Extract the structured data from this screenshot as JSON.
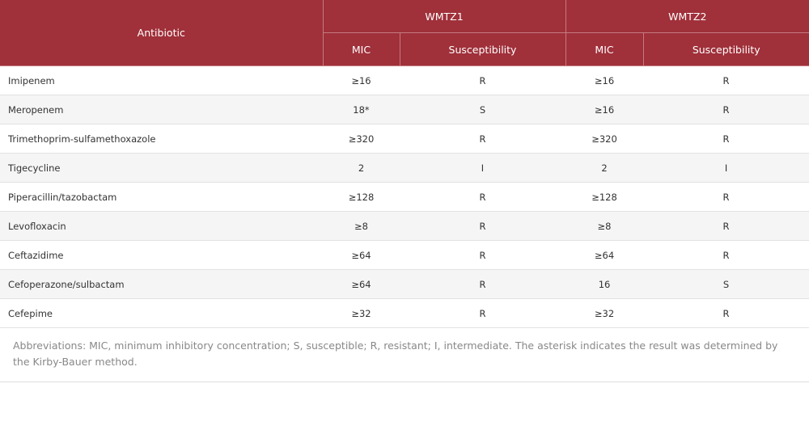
{
  "header": {
    "antibiotic": "Antibiotic",
    "strain1": "WMTZ1",
    "strain2": "WMTZ2",
    "mic": "MIC",
    "susceptibility": "Susceptibility"
  },
  "rows": [
    {
      "antibiotic": "Imipenem",
      "mic1": "≥16",
      "sus1": "R",
      "mic2": "≥16",
      "sus2": "R"
    },
    {
      "antibiotic": "Meropenem",
      "mic1": "18*",
      "sus1": "S",
      "mic2": "≥16",
      "sus2": "R"
    },
    {
      "antibiotic": "Trimethoprim-sulfamethoxazole",
      "mic1": "≥320",
      "sus1": "R",
      "mic2": "≥320",
      "sus2": "R"
    },
    {
      "antibiotic": "Tigecycline",
      "mic1": "2",
      "sus1": "I",
      "mic2": "2",
      "sus2": "I"
    },
    {
      "antibiotic": "Piperacillin/tazobactam",
      "mic1": "≥128",
      "sus1": "R",
      "mic2": "≥128",
      "sus2": "R"
    },
    {
      "antibiotic": "Levofloxacin",
      "mic1": "≥8",
      "sus1": "R",
      "mic2": "≥8",
      "sus2": "R"
    },
    {
      "antibiotic": "Ceftazidime",
      "mic1": "≥64",
      "sus1": "R",
      "mic2": "≥64",
      "sus2": "R"
    },
    {
      "antibiotic": "Cefoperazone/sulbactam",
      "mic1": "≥64",
      "sus1": "R",
      "mic2": "16",
      "sus2": "S"
    },
    {
      "antibiotic": "Cefepime",
      "mic1": "≥32",
      "sus1": "R",
      "mic2": "≥32",
      "sus2": "R"
    }
  ],
  "footnote": "Abbreviations: MIC, minimum inhibitory concentration; S, susceptible; R, resistant; I, intermediate. The asterisk indicates the result was determined by the Kirby-Bauer method.",
  "colors": {
    "header_bg": "#a0303a",
    "header_text": "#ffffff",
    "stripe": "#f5f5f5"
  }
}
